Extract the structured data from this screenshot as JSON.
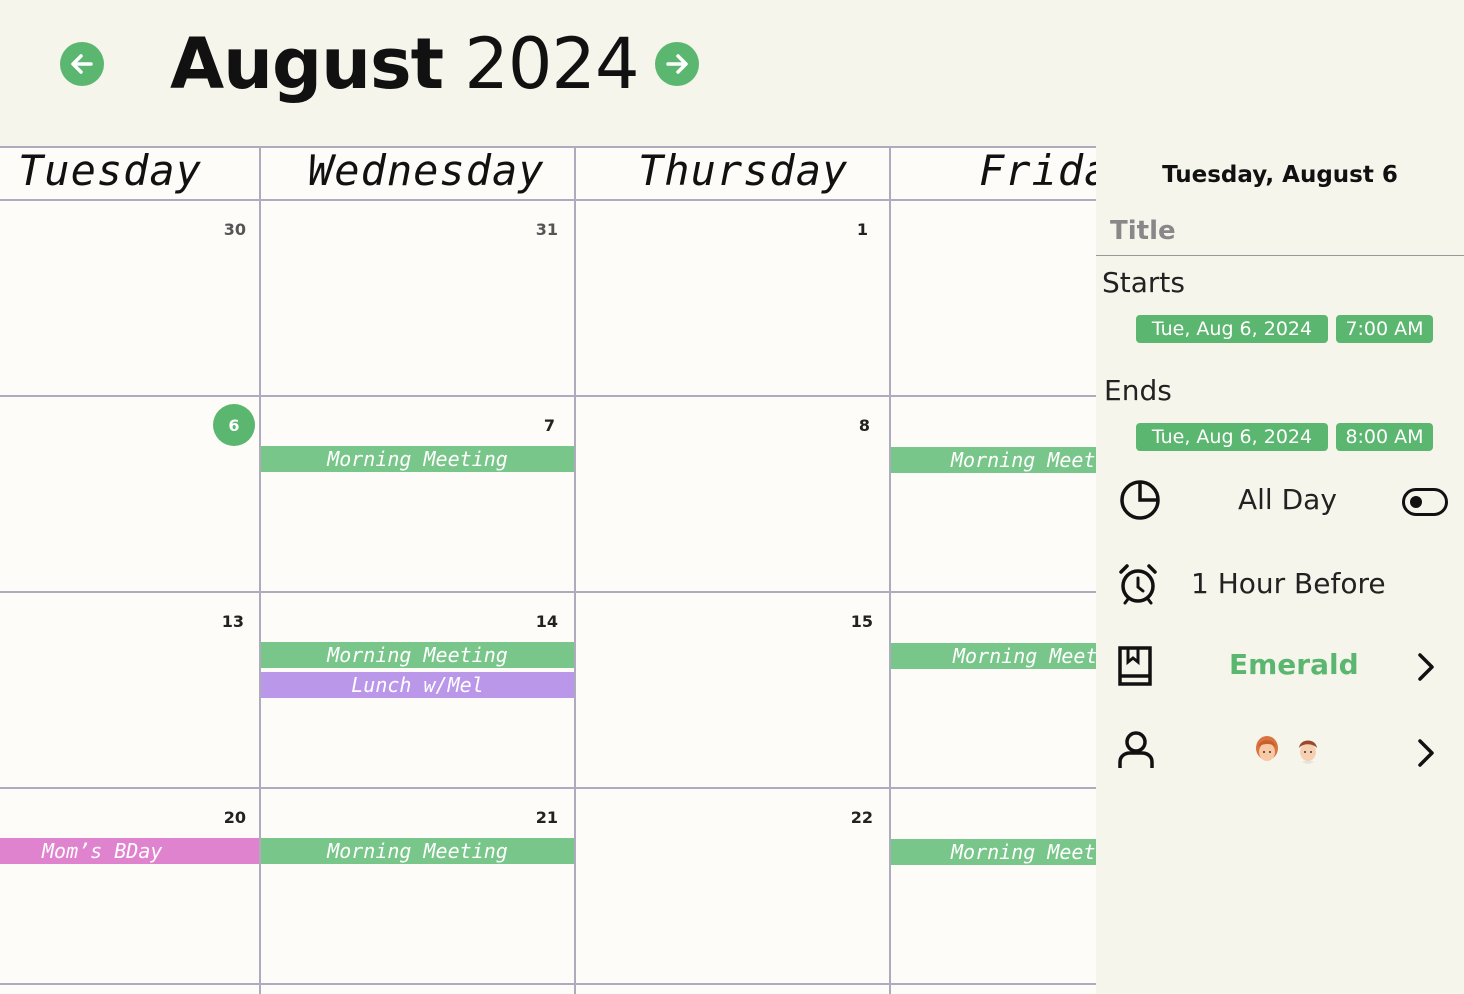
{
  "header": {
    "month": "August",
    "year": "2024",
    "prev_icon": "arrow-left-icon",
    "next_icon": "arrow-right-icon"
  },
  "accent_color": "#5bb66f",
  "days": [
    "Tuesday",
    "Wednesday",
    "Thursday",
    "Friday"
  ],
  "weeks": [
    {
      "dates": [
        "30",
        "31",
        "1",
        ""
      ]
    },
    {
      "dates": [
        "6",
        "7",
        "8",
        ""
      ]
    },
    {
      "dates": [
        "13",
        "14",
        "15",
        ""
      ]
    },
    {
      "dates": [
        "20",
        "21",
        "22",
        ""
      ]
    }
  ],
  "events": {
    "wed_7": "Morning Meeting",
    "fri_w2": "Morning Meeting",
    "wed_14": "Morning Meeting",
    "wed_14_lunch": "Lunch w/Mel",
    "fri_w3": "Morning Meeting",
    "tue_20": "Mom’s BDay",
    "wed_21": "Morning Meeting",
    "fri_w4": "Morning Meeting"
  },
  "event_colors": {
    "meeting": "#79c68a",
    "lunch": "#bb97e9",
    "birthday": "#e083cf"
  },
  "panel": {
    "date": "Tuesday, August 6",
    "title_placeholder": "Title",
    "starts_label": "Starts",
    "start_date": "Tue, Aug 6, 2024",
    "start_time": "7:00 AM",
    "ends_label": "Ends",
    "end_date": "Tue, Aug 6, 2024",
    "end_time": "8:00 AM",
    "all_day_label": "All Day",
    "all_day_on": false,
    "alert": "1 Hour Before",
    "calendar": "Emerald",
    "calendar_color": "#5bb66f",
    "icons": [
      "clock-icon",
      "alarm-icon",
      "bookmark-icon",
      "person-icon"
    ]
  }
}
